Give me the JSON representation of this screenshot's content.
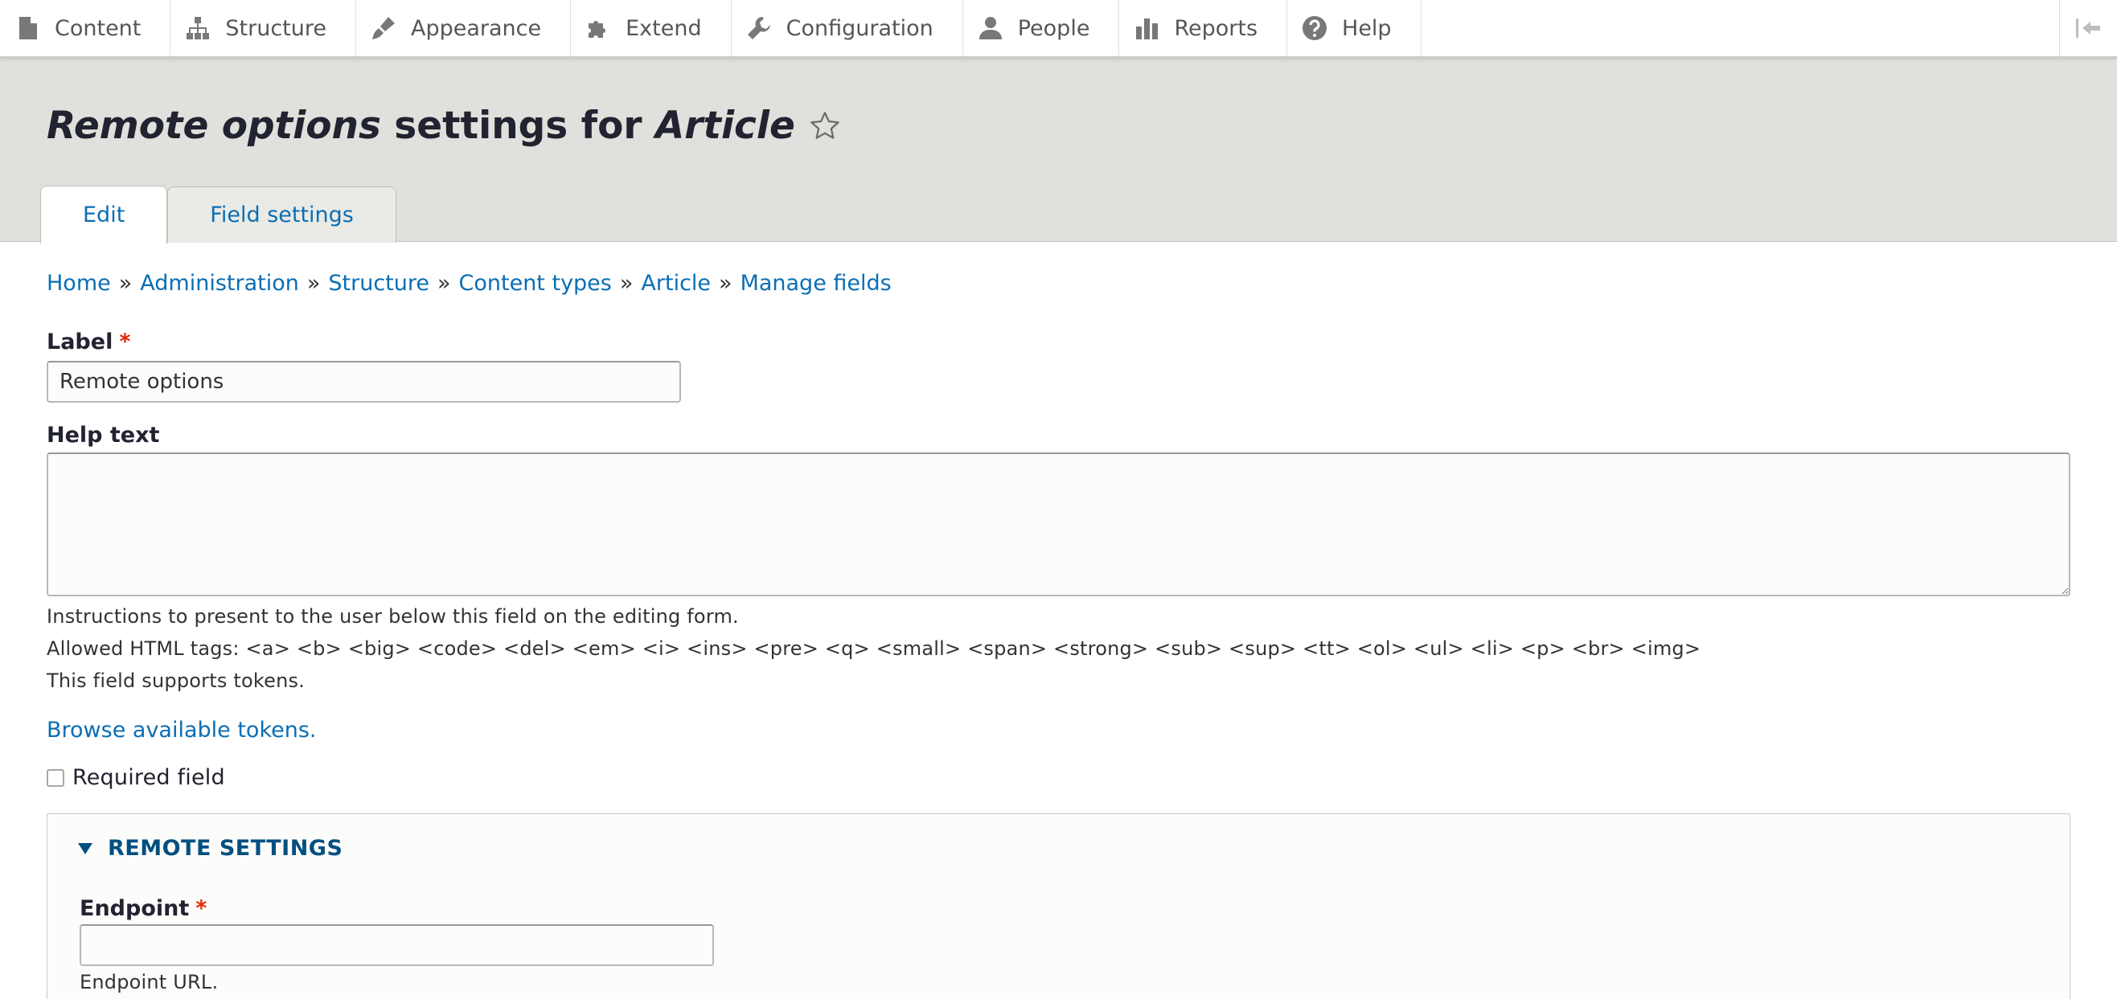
{
  "toolbar": {
    "items": [
      {
        "label": "Content",
        "icon": "file-icon"
      },
      {
        "label": "Structure",
        "icon": "sitemap-icon"
      },
      {
        "label": "Appearance",
        "icon": "paintbrush-icon"
      },
      {
        "label": "Extend",
        "icon": "puzzle-icon"
      },
      {
        "label": "Configuration",
        "icon": "wrench-icon"
      },
      {
        "label": "People",
        "icon": "person-icon"
      },
      {
        "label": "Reports",
        "icon": "bar-chart-icon"
      },
      {
        "label": "Help",
        "icon": "question-icon"
      }
    ],
    "toggle_icon": "collapse-left-icon"
  },
  "header": {
    "title_part1": "Remote options",
    "title_part2": " settings for ",
    "title_part3": "Article",
    "tabs": [
      {
        "label": "Edit",
        "active": true
      },
      {
        "label": "Field settings",
        "active": false
      }
    ]
  },
  "breadcrumb": {
    "items": [
      "Home",
      "Administration",
      "Structure",
      "Content types",
      "Article",
      "Manage fields"
    ],
    "separator": "»"
  },
  "form": {
    "label_field": {
      "label": "Label",
      "required_mark": "*",
      "value": "Remote options"
    },
    "help_text": {
      "label": "Help text",
      "value": "",
      "description_1": "Instructions to present to the user below this field on the editing form.",
      "description_2": "Allowed HTML tags: <a> <b> <big> <code> <del> <em> <i> <ins> <pre> <q> <small> <span> <strong> <sub> <sup> <tt> <ol> <ul> <li> <p> <br> <img>",
      "description_3": "This field supports tokens."
    },
    "browse_tokens": "Browse available tokens.",
    "required_field": {
      "label": "Required field",
      "checked": false
    },
    "remote_settings": {
      "summary": "REMOTE SETTINGS",
      "endpoint": {
        "label": "Endpoint",
        "required_mark": "*",
        "value": "",
        "description": "Endpoint URL."
      }
    }
  },
  "colors": {
    "link": "#0a6eb4",
    "required": "#e62600",
    "header_bg": "#e0e0dc",
    "summary": "#004f80"
  }
}
